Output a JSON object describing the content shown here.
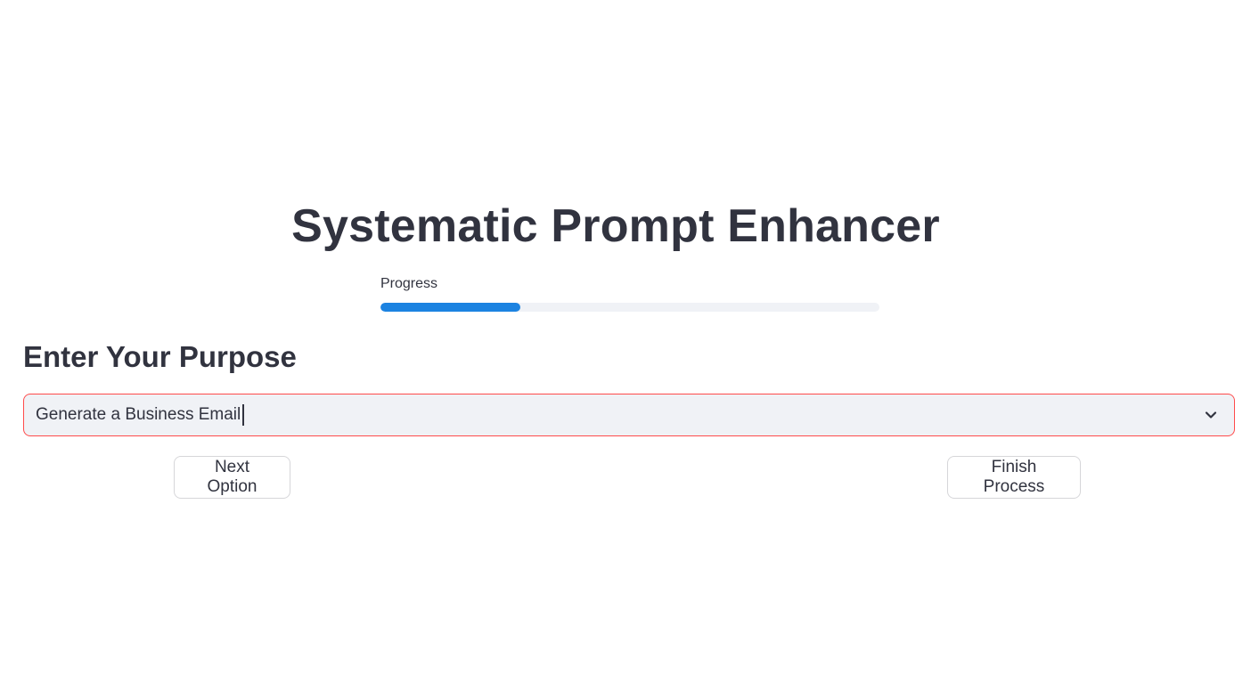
{
  "header": {
    "title": "Systematic Prompt Enhancer"
  },
  "progress": {
    "label": "Progress",
    "value": 0.28,
    "fill_color": "#1c83e1",
    "track_color": "#f0f2f6"
  },
  "purpose": {
    "heading": "Enter Your Purpose",
    "select_value": "Generate a Business Email",
    "border_color": "#ff4b4b",
    "icon": "chevron-down-icon"
  },
  "actions": {
    "next_label": "Next Option",
    "finish_label": "Finish Process"
  }
}
